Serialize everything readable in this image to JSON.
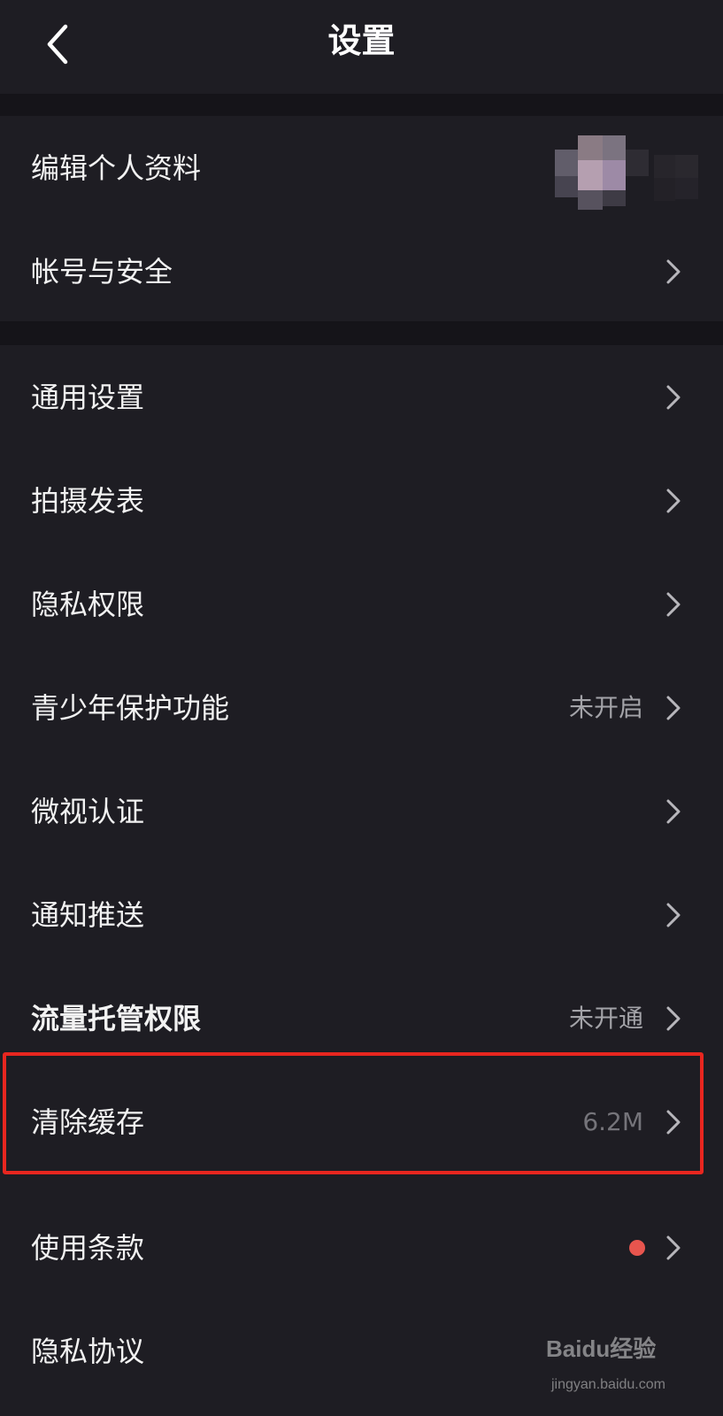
{
  "header": {
    "title": "设置"
  },
  "groups": [
    {
      "items": [
        {
          "label": "编辑个人资料",
          "value": ""
        },
        {
          "label": "帐号与安全",
          "value": ""
        }
      ]
    },
    {
      "items": [
        {
          "label": "通用设置",
          "value": ""
        },
        {
          "label": "拍摄发表",
          "value": ""
        },
        {
          "label": "隐私权限",
          "value": ""
        },
        {
          "label": "青少年保护功能",
          "value": "未开启"
        },
        {
          "label": "微视认证",
          "value": ""
        },
        {
          "label": "通知推送",
          "value": ""
        },
        {
          "label": "流量托管权限",
          "value": "未开通"
        },
        {
          "label": "清除缓存",
          "value": "6.2M"
        },
        {
          "label": "使用条款",
          "value": ""
        },
        {
          "label": "隐私协议",
          "value": ""
        }
      ]
    }
  ],
  "colors": {
    "background": "#151419",
    "row_background": "#1e1d23",
    "highlight_border": "#e8261f",
    "notification_dot": "#e8554e"
  },
  "watermark": {
    "logo": "Baidu经验",
    "url": "jingyan.baidu.com"
  }
}
